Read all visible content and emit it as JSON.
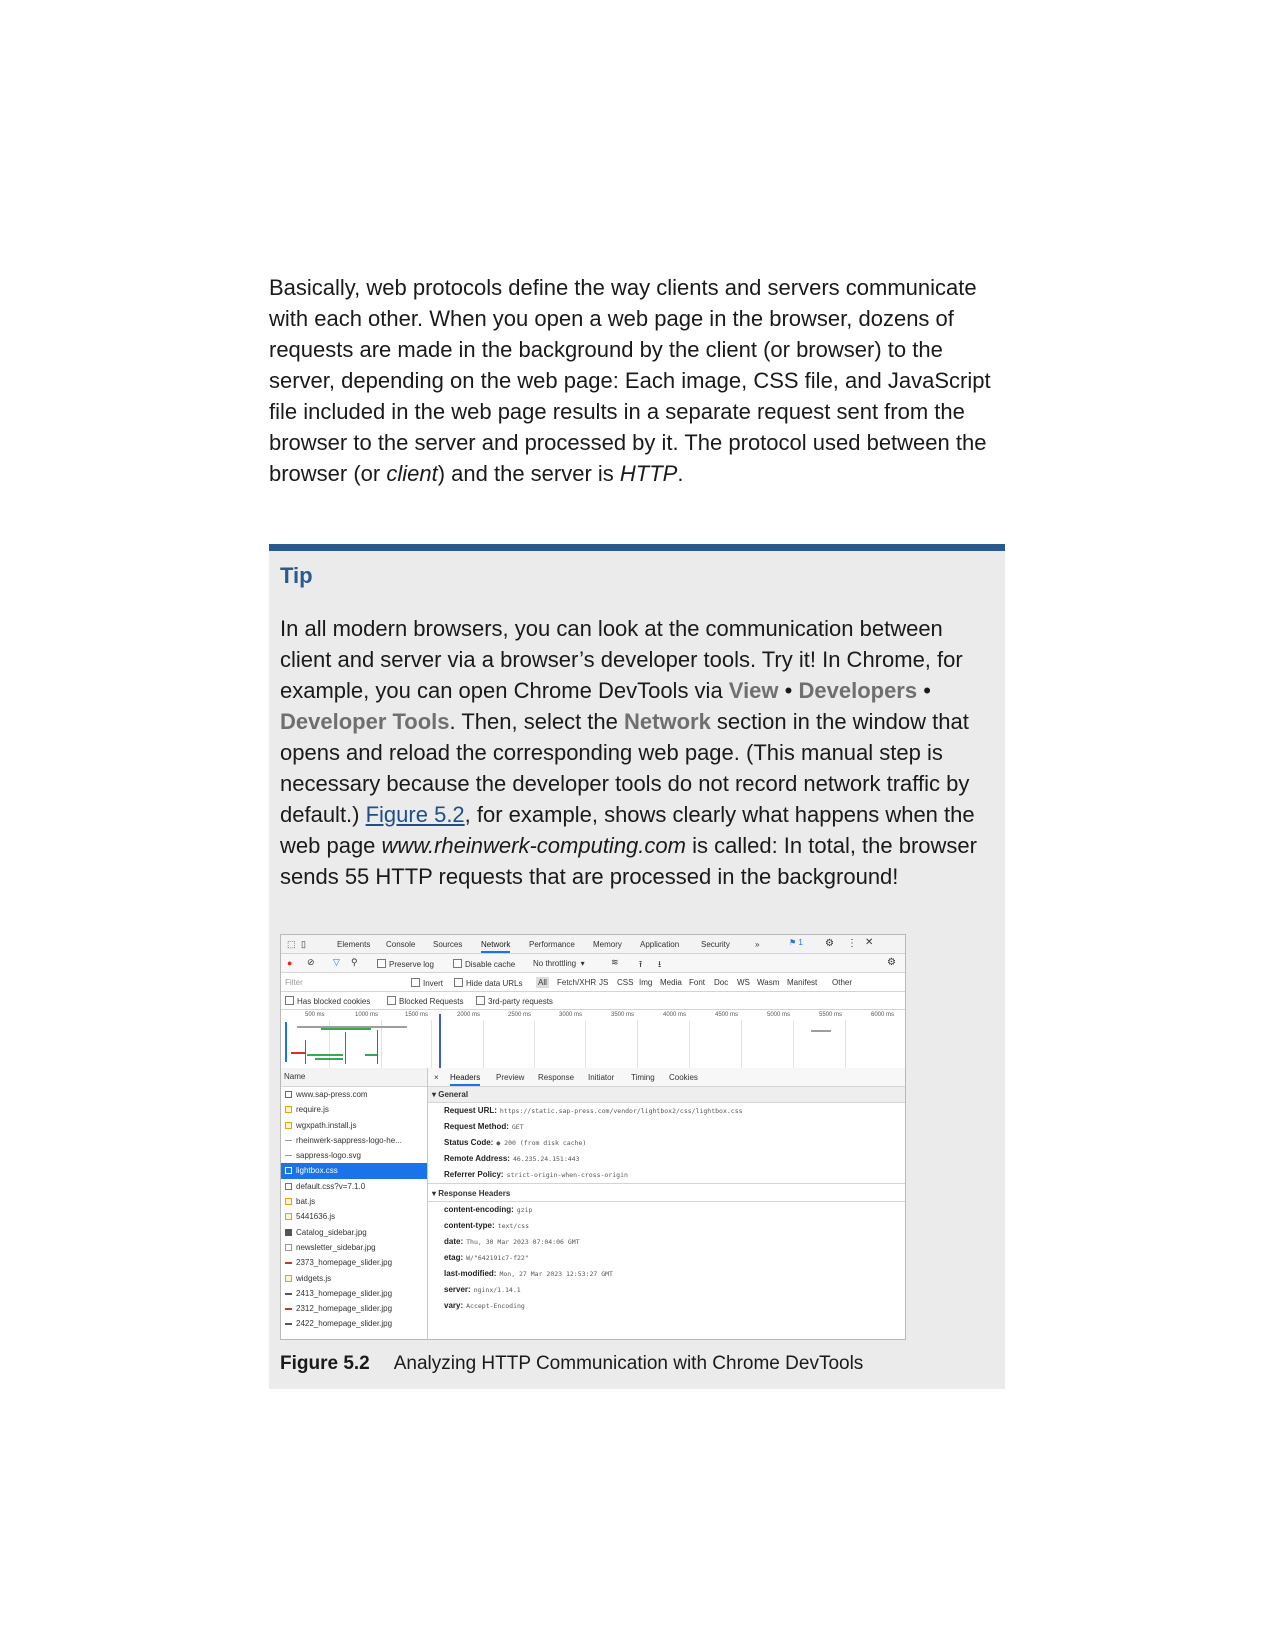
{
  "intro": {
    "p1": "Basically, web protocols define the way clients and servers communicate with each other. When you open a web page in the browser, dozens of requests are made in the background by the client (or browser) to the server, depending on the web page: Each image, CSS file, and JavaScript file included in the web page results in a separate request sent from the browser to the server and processed by it. The protocol used between the browser (or ",
    "p1_em": "client",
    "p2": ") and the server is ",
    "p2_em": "HTTP",
    "p3": "."
  },
  "tip": {
    "title": "Tip",
    "t1": "In all modern browsers, you can look at the communication between client and server via a browser’s developer tools. Try it! In Chrome, for example, you can open Chrome DevTools via ",
    "ui_view": "View",
    "bullet": " • ",
    "ui_developers": "Developers",
    "ui_devtools": "Developer Tools",
    "t2": ". Then, select the ",
    "ui_network": "Network",
    "t3": " section in the window that opens and reload the corresponding web page. (This manual step is necessary because the developer tools do not record network traffic by default.) ",
    "figure_link": "Figure 5.2",
    "t4": ", for example, shows clearly what happens when the web page ",
    "site_em": "www.rheinwerk-computing.com",
    "t5": " is called: In total, the browser sends 55 HTTP requests that are processed in the background!"
  },
  "figure": {
    "label": "Figure 5.2",
    "caption": "Analyzing HTTP Communication with Chrome DevTools"
  },
  "devtools": {
    "tabs": [
      "Elements",
      "Console",
      "Sources",
      "Network",
      "Performance",
      "Memory",
      "Application",
      "Security",
      "»"
    ],
    "issues_count": "1",
    "controls": {
      "preserve_log": "Preserve log",
      "disable_cache": "Disable cache",
      "throttling": "No throttling"
    },
    "filter": {
      "placeholder": "Filter",
      "invert": "Invert",
      "hide_data_urls": "Hide data URLs",
      "types": [
        "All",
        "Fetch/XHR",
        "JS",
        "CSS",
        "Img",
        "Media",
        "Font",
        "Doc",
        "WS",
        "Wasm",
        "Manifest",
        "Other"
      ]
    },
    "blocked": {
      "has_blocked_cookies": "Has blocked cookies",
      "blocked_requests": "Blocked Requests",
      "third_party": "3rd-party requests"
    },
    "timeline_ticks": [
      "500 ms",
      "1000 ms",
      "1500 ms",
      "2000 ms",
      "2500 ms",
      "3000 ms",
      "3500 ms",
      "4000 ms",
      "4500 ms",
      "5000 ms",
      "5500 ms",
      "6000 ms"
    ],
    "name_header": "Name",
    "requests": [
      "www.sap-press.com",
      "require.js",
      "wgxpath.install.js",
      "rheinwerk-sappress-logo-he...",
      "sappress-logo.svg",
      "lightbox.css",
      "default.css?v=7.1.0",
      "bat.js",
      "5441636.js",
      "Catalog_sidebar.jpg",
      "newsletter_sidebar.jpg",
      "2373_homepage_slider.jpg",
      "widgets.js",
      "2413_homepage_slider.jpg",
      "2312_homepage_slider.jpg",
      "2422_homepage_slider.jpg"
    ],
    "selected_index": 5,
    "detail_tabs": [
      "Headers",
      "Preview",
      "Response",
      "Initiator",
      "Timing",
      "Cookies"
    ],
    "close_glyph": "×",
    "general_title": "General",
    "general": [
      {
        "k": "Request URL:",
        "v": "https://static.sap-press.com/vendor/lightbox2/css/lightbox.css"
      },
      {
        "k": "Request Method:",
        "v": "GET"
      },
      {
        "k": "Status Code:",
        "v": "● 200  (from disk cache)"
      },
      {
        "k": "Remote Address:",
        "v": "46.235.24.151:443"
      },
      {
        "k": "Referrer Policy:",
        "v": "strict-origin-when-cross-origin"
      }
    ],
    "response_title": "Response Headers",
    "response": [
      {
        "k": "content-encoding:",
        "v": "gzip"
      },
      {
        "k": "content-type:",
        "v": "text/css"
      },
      {
        "k": "date:",
        "v": "Thu, 30 Mar 2023 07:04:06 GMT"
      },
      {
        "k": "etag:",
        "v": "W/\"642191c7-f22\""
      },
      {
        "k": "last-modified:",
        "v": "Mon, 27 Mar 2023 12:53:27 GMT"
      },
      {
        "k": "server:",
        "v": "nginx/1.14.1"
      },
      {
        "k": "vary:",
        "v": "Accept-Encoding"
      }
    ]
  }
}
